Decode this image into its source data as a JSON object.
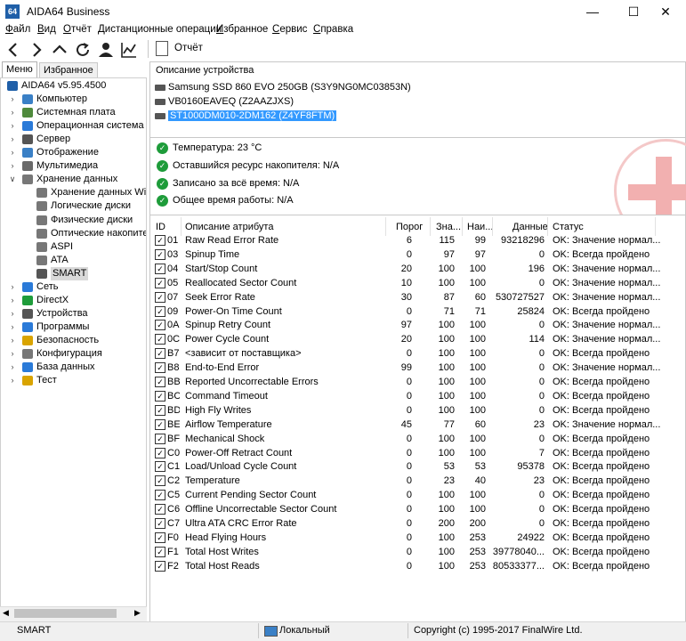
{
  "window": {
    "title": "AIDA64 Business",
    "app_icon": "64",
    "controls": [
      "minimize-icon",
      "maximize-icon",
      "close-icon"
    ]
  },
  "menu": [
    {
      "label": "Файл",
      "ul": "Ф",
      "rest": "айл"
    },
    {
      "label": "Вид",
      "ul": "В",
      "rest": "ид"
    },
    {
      "label": "Отчёт",
      "ul": "О",
      "rest": "тчёт"
    },
    {
      "label": "Дистанционные операции",
      "ul": "Д",
      "rest": "истанционные операции"
    },
    {
      "label": "Избранное",
      "ul": "И",
      "rest": "збранное"
    },
    {
      "label": "Сервис",
      "ul": "С",
      "rest": "ервис"
    },
    {
      "label": "Справка",
      "ul": "С",
      "rest": "правка"
    }
  ],
  "toolbar": {
    "icons": [
      "back-icon",
      "forward-icon",
      "up-icon",
      "refresh-icon",
      "user-icon",
      "chart-icon"
    ],
    "report_label": "Отчёт"
  },
  "left_tabs": [
    "Меню",
    "Избранное"
  ],
  "tree": [
    {
      "label": "AIDA64 v5.95.4500",
      "level": 0,
      "exp": "",
      "icon": "aida64-icon",
      "color": "#1f5fa8"
    },
    {
      "label": "Компьютер",
      "level": 1,
      "exp": ">",
      "icon": "computer-icon",
      "color": "#3a80c6"
    },
    {
      "label": "Системная плата",
      "level": 1,
      "exp": ">",
      "icon": "motherboard-icon",
      "color": "#4f8a3c"
    },
    {
      "label": "Операционная система",
      "level": 1,
      "exp": ">",
      "icon": "windows-icon",
      "color": "#2a7ad8"
    },
    {
      "label": "Сервер",
      "level": 1,
      "exp": ">",
      "icon": "server-icon",
      "color": "#555555"
    },
    {
      "label": "Отображение",
      "level": 1,
      "exp": ">",
      "icon": "display-icon",
      "color": "#3a80c6"
    },
    {
      "label": "Мультимедиа",
      "level": 1,
      "exp": ">",
      "icon": "multimedia-icon",
      "color": "#6a6a6a"
    },
    {
      "label": "Хранение данных",
      "level": 1,
      "exp": "v",
      "icon": "storage-icon",
      "color": "#777777"
    },
    {
      "label": "Хранение данных Windows",
      "level": 2,
      "exp": "",
      "icon": "drive-icon",
      "color": "#777777"
    },
    {
      "label": "Логические диски",
      "level": 2,
      "exp": "",
      "icon": "drive-icon",
      "color": "#777777"
    },
    {
      "label": "Физические диски",
      "level": 2,
      "exp": "",
      "icon": "drive-icon",
      "color": "#777777"
    },
    {
      "label": "Оптические накопители",
      "level": 2,
      "exp": "",
      "icon": "optical-drive-icon",
      "color": "#777777"
    },
    {
      "label": "ASPI",
      "level": 2,
      "exp": "",
      "icon": "drive-icon",
      "color": "#777777"
    },
    {
      "label": "ATA",
      "level": 2,
      "exp": "",
      "icon": "drive-icon",
      "color": "#777777"
    },
    {
      "label": "SMART",
      "level": 2,
      "exp": "",
      "icon": "drive-icon",
      "color": "#555555",
      "selected": true
    },
    {
      "label": "Сеть",
      "level": 1,
      "exp": ">",
      "icon": "network-icon",
      "color": "#2a7ad8"
    },
    {
      "label": "DirectX",
      "level": 1,
      "exp": ">",
      "icon": "directx-icon",
      "color": "#1e9c3a"
    },
    {
      "label": "Устройства",
      "level": 1,
      "exp": ">",
      "icon": "devices-icon",
      "color": "#555555"
    },
    {
      "label": "Программы",
      "level": 1,
      "exp": ">",
      "icon": "programs-icon",
      "color": "#2a7ad8"
    },
    {
      "label": "Безопасность",
      "level": 1,
      "exp": ">",
      "icon": "security-icon",
      "color": "#d9a400"
    },
    {
      "label": "Конфигурация",
      "level": 1,
      "exp": ">",
      "icon": "configuration-icon",
      "color": "#777777"
    },
    {
      "label": "База данных",
      "level": 1,
      "exp": ">",
      "icon": "database-icon",
      "color": "#2a7ad8"
    },
    {
      "label": "Тест",
      "level": 1,
      "exp": ">",
      "icon": "test-icon",
      "color": "#d9a400"
    }
  ],
  "device_panel": {
    "header": "Описание устройства",
    "devices": [
      {
        "label": "Samsung SSD 860 EVO 250GB (S3Y9NG0MC03853N)",
        "selected": false
      },
      {
        "label": "VB0160EAVEQ (Z2AAZJXS)",
        "selected": false
      },
      {
        "label": "ST1000DM010-2DM162 (Z4YF8FTM)",
        "selected": true
      }
    ]
  },
  "status_panel": {
    "items": [
      "Температура: 23 °C",
      "Оставшийся ресурс накопителя: N/A",
      "Записано за всё время: N/A",
      "Общее время работы: N/A"
    ]
  },
  "table": {
    "headers": [
      "ID",
      "Описание атрибута",
      "Порог",
      "Зна...",
      "Наи...",
      "Данные",
      "Статус"
    ],
    "rows": [
      [
        "01",
        "Raw Read Error Rate",
        "6",
        "115",
        "99",
        "93218296",
        "OK: Значение нормал..."
      ],
      [
        "03",
        "Spinup Time",
        "0",
        "97",
        "97",
        "0",
        "OK: Всегда пройдено"
      ],
      [
        "04",
        "Start/Stop Count",
        "20",
        "100",
        "100",
        "196",
        "OK: Значение нормал..."
      ],
      [
        "05",
        "Reallocated Sector Count",
        "10",
        "100",
        "100",
        "0",
        "OK: Значение нормал..."
      ],
      [
        "07",
        "Seek Error Rate",
        "30",
        "87",
        "60",
        "530727527",
        "OK: Значение нормал..."
      ],
      [
        "09",
        "Power-On Time Count",
        "0",
        "71",
        "71",
        "25824",
        "OK: Всегда пройдено"
      ],
      [
        "0A",
        "Spinup Retry Count",
        "97",
        "100",
        "100",
        "0",
        "OK: Значение нормал..."
      ],
      [
        "0C",
        "Power Cycle Count",
        "20",
        "100",
        "100",
        "114",
        "OK: Значение нормал..."
      ],
      [
        "B7",
        "<зависит от поставщика>",
        "0",
        "100",
        "100",
        "0",
        "OK: Всегда пройдено"
      ],
      [
        "B8",
        "End-to-End Error",
        "99",
        "100",
        "100",
        "0",
        "OK: Значение нормал..."
      ],
      [
        "BB",
        "Reported Uncorrectable Errors",
        "0",
        "100",
        "100",
        "0",
        "OK: Всегда пройдено"
      ],
      [
        "BC",
        "Command Timeout",
        "0",
        "100",
        "100",
        "0",
        "OK: Всегда пройдено"
      ],
      [
        "BD",
        "High Fly Writes",
        "0",
        "100",
        "100",
        "0",
        "OK: Всегда пройдено"
      ],
      [
        "BE",
        "Airflow Temperature",
        "45",
        "77",
        "60",
        "23",
        "OK: Значение нормал..."
      ],
      [
        "BF",
        "Mechanical Shock",
        "0",
        "100",
        "100",
        "0",
        "OK: Всегда пройдено"
      ],
      [
        "C0",
        "Power-Off Retract Count",
        "0",
        "100",
        "100",
        "7",
        "OK: Всегда пройдено"
      ],
      [
        "C1",
        "Load/Unload Cycle Count",
        "0",
        "53",
        "53",
        "95378",
        "OK: Всегда пройдено"
      ],
      [
        "C2",
        "Temperature",
        "0",
        "23",
        "40",
        "23",
        "OK: Всегда пройдено"
      ],
      [
        "C5",
        "Current Pending Sector Count",
        "0",
        "100",
        "100",
        "0",
        "OK: Всегда пройдено"
      ],
      [
        "C6",
        "Offline Uncorrectable Sector Count",
        "0",
        "100",
        "100",
        "0",
        "OK: Всегда пройдено"
      ],
      [
        "C7",
        "Ultra ATA CRC Error Rate",
        "0",
        "200",
        "200",
        "0",
        "OK: Всегда пройдено"
      ],
      [
        "F0",
        "Head Flying Hours",
        "0",
        "100",
        "253",
        "24922",
        "OK: Всегда пройдено"
      ],
      [
        "F1",
        "Total Host Writes",
        "0",
        "100",
        "253",
        "39778040...",
        "OK: Всегда пройдено"
      ],
      [
        "F2",
        "Total Host Reads",
        "0",
        "100",
        "253",
        "80533377...",
        "OK: Всегда пройдено"
      ]
    ]
  },
  "statusbar": {
    "left": "SMART",
    "middle": "Локальный",
    "right": "Copyright (c) 1995-2017 FinalWire Ltd."
  }
}
